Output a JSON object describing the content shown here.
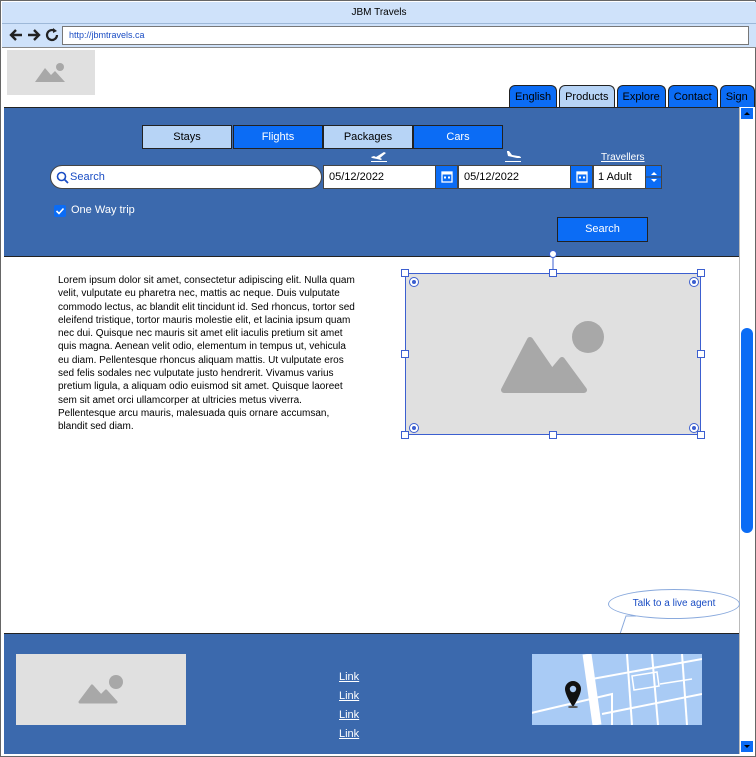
{
  "window": {
    "title": "JBM Travels"
  },
  "address_bar": {
    "url": "http://jbmtravels.ca"
  },
  "nav_tabs": [
    {
      "label": "English",
      "active": false
    },
    {
      "label": "Products",
      "active": true
    },
    {
      "label": "Explore",
      "active": false
    },
    {
      "label": "Contact",
      "active": false
    },
    {
      "label": "Sign in",
      "active": false
    }
  ],
  "booking": {
    "modes": [
      {
        "label": "Stays",
        "selected": true
      },
      {
        "label": "Flights",
        "selected": false
      },
      {
        "label": "Packages",
        "selected": true
      },
      {
        "label": "Cars",
        "selected": false
      }
    ],
    "search_placeholder": "Search",
    "depart_date": "05/12/2022",
    "return_date": "05/12/2022",
    "travellers_label": "Travellers",
    "travellers_value": "1 Adult",
    "one_way_label": "One Way trip",
    "one_way_checked": true,
    "search_button": "Search"
  },
  "content": {
    "body_text": "Lorem ipsum dolor sit amet, consectetur adipiscing elit. Nulla quam velit, vulputate eu pharetra nec, mattis ac neque. Duis vulputate commodo lectus, ac blandit elit tincidunt id. Sed rhoncus, tortor sed eleifend tristique, tortor mauris molestie elit, et lacinia ipsum quam nec dui. Quisque nec mauris sit amet elit iaculis pretium sit amet quis magna. Aenean velit odio, elementum in tempus ut, vehicula eu diam. Pellentesque rhoncus aliquam mattis. Ut vulputate eros sed felis sodales nec vulputate justo hendrerit. Vivamus varius pretium ligula, a aliquam odio euismod sit amet. Quisque laoreet sem sit amet orci ullamcorper at ultricies metus viverra. Pellentesque arcu mauris, malesuada quis ornare accumsan, blandit sed diam."
  },
  "live_agent": {
    "label": "Talk to a live agent"
  },
  "footer": {
    "links": [
      "Link",
      "Link",
      "Link",
      "Link"
    ]
  },
  "colors": {
    "band": "#3b69ad",
    "button_blue": "#0b6cf5",
    "light_blue": "#b7d4f6",
    "placeholder_gray": "#e0e0e0"
  },
  "icons": [
    "back-arrow-icon",
    "forward-arrow-icon",
    "reload-icon",
    "search-icon",
    "calendar-icon",
    "takeoff-icon",
    "landing-icon",
    "checkbox-checked-icon",
    "image-placeholder-icon",
    "map-pin-icon"
  ]
}
